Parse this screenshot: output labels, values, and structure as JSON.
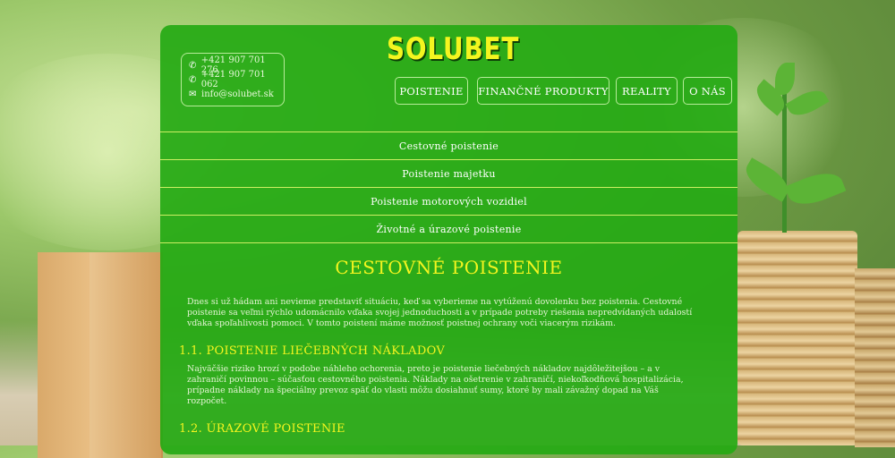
{
  "site": {
    "logo": "SOLUBET"
  },
  "contact": {
    "phone1": "+421 907 701 276",
    "phone2": "+421 907 701 062",
    "email": "info@solubet.sk"
  },
  "nav": {
    "items": [
      "POISTENIE",
      "FINANČNÉ PRODUKTY",
      "REALITY",
      "O NÁS"
    ]
  },
  "submenu": {
    "items": [
      "Cestovné poistenie",
      "Poistenie majetku",
      "Poistenie motorových vozidiel",
      "Životné a úrazové poistenie"
    ]
  },
  "content": {
    "title": "CESTOVNÉ POISTENIE",
    "intro_lines": [
      "Dnes si už hádam ani nevieme predstaviť situáciu, keď sa vyberieme na vytúženú dovolenku bez poistenia. Cestovné",
      "poistenie sa veľmi rýchlo udomácnilo vďaka svojej jednoduchosti a v prípade potreby riešenia nepredvídaných udalostí",
      "vďaka spoľahlivosti pomoci. V tomto poistení máme možnosť poistnej ochrany voči viacerým rizikám."
    ],
    "section1_title": "1.1. POISTENIE LIEČEBNÝCH NÁKLADOV",
    "section1_lines": [
      "Najväčšie riziko hrozí v podobe náhleho ochorenia, preto je poistenie liečebných nákladov najdôležitejšou – a v",
      "zahraničí povinnou – súčasťou cestovného poistenia. Náklady na ošetrenie v zahraničí, niekoľkodňová hospitalizácia,",
      "prípadne náklady na špeciálny prevoz späť do vlasti môžu dosiahnuť sumy, ktoré by mali závažný dopad na Váš",
      "rozpočet."
    ],
    "section2_title": "1.2. ÚRAZOVÉ POISTENIE"
  },
  "colors": {
    "panel": "#26aa14",
    "accent": "#f4f51f",
    "divider": "#cdef63"
  }
}
